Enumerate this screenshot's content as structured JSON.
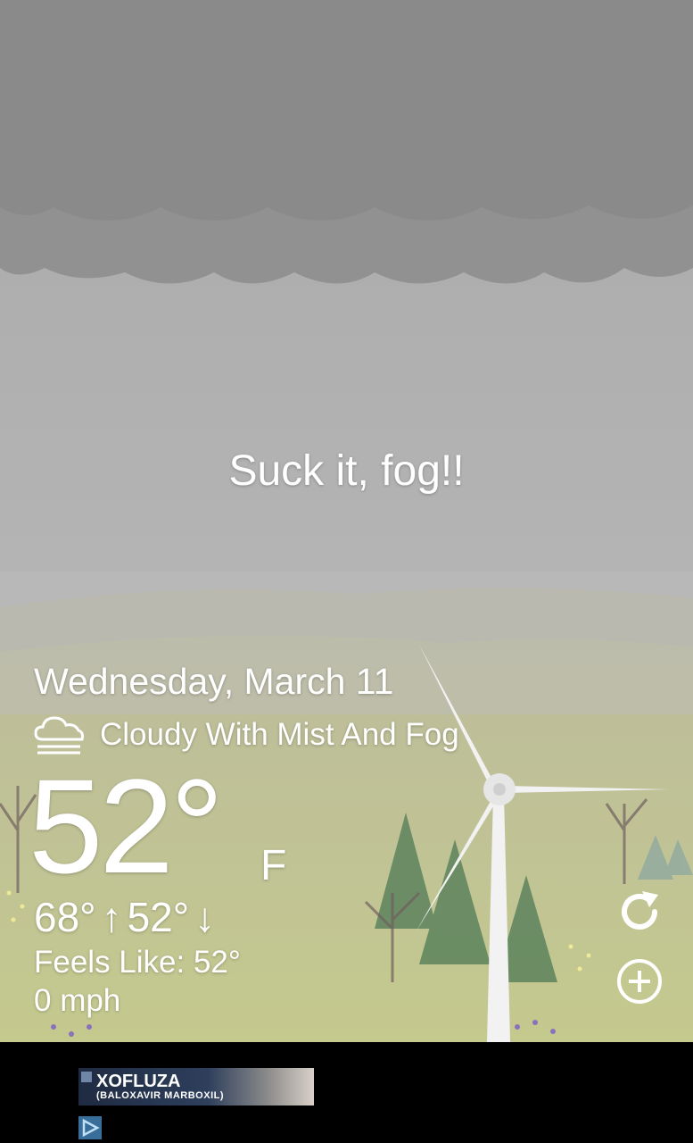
{
  "weather": {
    "message": "Suck it, fog!!",
    "date": "Wednesday, March 11",
    "condition": "Cloudy With Mist And Fog",
    "condition_icon": "cloud-fog-icon",
    "temperature": "52°",
    "unit": "F",
    "high": "68°",
    "low": "52°",
    "feels_like": "Feels Like: 52°",
    "wind": "0 mph"
  },
  "actions": {
    "refresh_icon": "refresh-icon",
    "add_icon": "add-location-icon"
  },
  "ad": {
    "brand": "XOFLUZA",
    "subtitle": "(BALOXAVIR MARBOXIL)",
    "choices_icon": "adchoices-icon"
  },
  "colors": {
    "sky": "#b4b4b4",
    "cloud": "#8f8f8f",
    "meadow": "#c6c595",
    "ad_bar": "#000000"
  }
}
